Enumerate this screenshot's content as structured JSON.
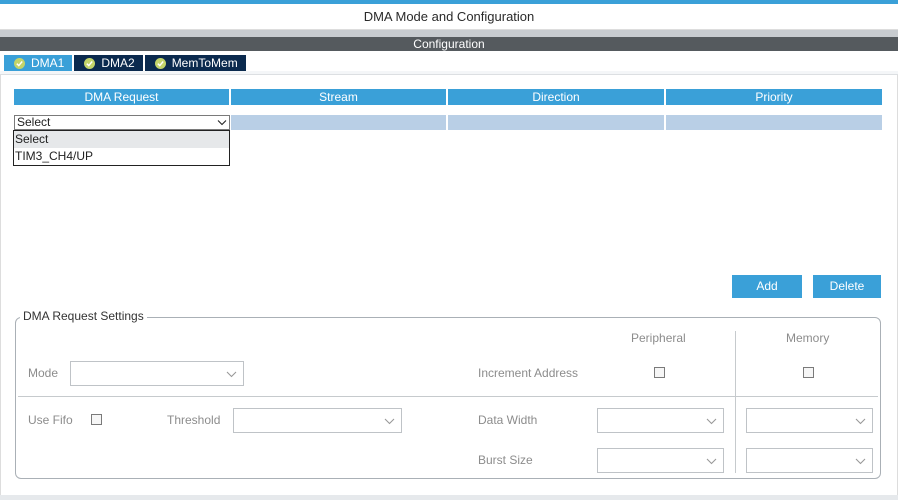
{
  "window": {
    "title": "DMA Mode and Configuration"
  },
  "config_header": "Configuration",
  "tabs": [
    {
      "label": "DMA1",
      "icon": "check-circle-icon",
      "active": true
    },
    {
      "label": "DMA2",
      "icon": "check-circle-icon",
      "active": false
    },
    {
      "label": "MemToMem",
      "icon": "check-circle-icon",
      "active": false
    }
  ],
  "table": {
    "columns": [
      "DMA Request",
      "Stream",
      "Direction",
      "Priority"
    ],
    "row": {
      "dma_request": "Select",
      "stream": "",
      "direction": "",
      "priority": ""
    }
  },
  "dropdown": {
    "options": [
      "Select",
      "TIM3_CH4/UP"
    ],
    "selected": "Select"
  },
  "buttons": {
    "add": "Add",
    "delete": "Delete"
  },
  "settings": {
    "title": "DMA Request Settings",
    "peripheral_label": "Peripheral",
    "memory_label": "Memory",
    "mode_label": "Mode",
    "mode_value": "",
    "increment_address_label": "Increment Address",
    "use_fifo_label": "Use Fifo",
    "threshold_label": "Threshold",
    "threshold_value": "",
    "data_width_label": "Data Width",
    "burst_size_label": "Burst Size",
    "peripheral_data_width": "",
    "memory_data_width": "",
    "peripheral_burst_size": "",
    "memory_burst_size": ""
  },
  "colors": {
    "accent": "#3aa0d8",
    "tab_inactive": "#0b2a4e",
    "header_dark": "#555a5e",
    "row_fill": "#b9cfe6",
    "check_green": "#c3d46a"
  }
}
